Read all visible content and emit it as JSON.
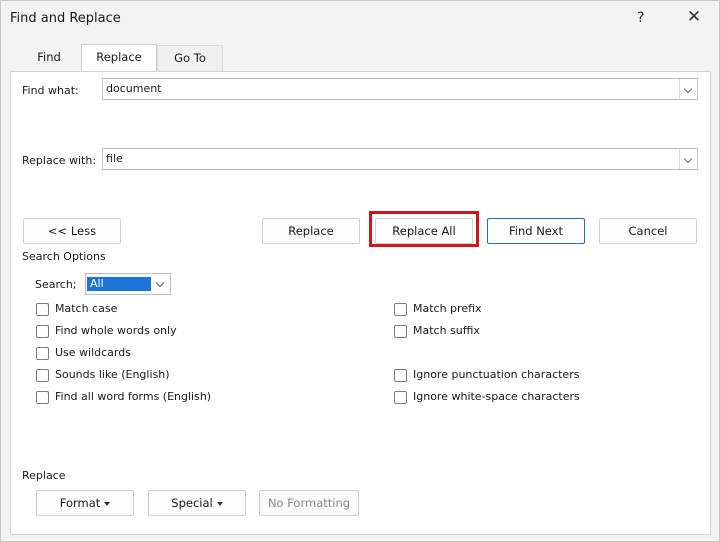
{
  "window": {
    "title": "Find and Replace",
    "help_label": "?",
    "close_label": "✕"
  },
  "tabs": [
    {
      "label": "Find",
      "active": false
    },
    {
      "label": "Replace",
      "active": true
    },
    {
      "label": "Go To",
      "active": false
    }
  ],
  "find": {
    "label": "Find what:",
    "value": "document"
  },
  "replace": {
    "label": "Replace with:",
    "value": "file"
  },
  "buttons": {
    "less": "<< Less",
    "replace": "Replace",
    "replace_all": "Replace All",
    "find_next": "Find Next",
    "cancel": "Cancel"
  },
  "search_options": {
    "heading": "Search Options",
    "search_label": "Search;",
    "search_value": "All",
    "left": [
      {
        "label": "Match case",
        "checked": false
      },
      {
        "label": "Find whole words only",
        "checked": false
      },
      {
        "label": "Use wildcards",
        "checked": false
      },
      {
        "label": "Sounds like (English)",
        "checked": false
      },
      {
        "label": "Find all word forms (English)",
        "checked": false
      }
    ],
    "right": [
      {
        "label": "Match prefix",
        "checked": false
      },
      {
        "label": "Match suffix",
        "checked": false
      },
      {
        "label": "Ignore punctuation characters",
        "checked": false
      },
      {
        "label": "Ignore white-space characters",
        "checked": false
      }
    ]
  },
  "replace_section": {
    "heading": "Replace",
    "format": "Format",
    "special": "Special",
    "no_formatting": "No Formatting"
  },
  "colors": {
    "accent": "#1e73d8",
    "highlight": "#d2151d",
    "primary_border": "#2a6fb5"
  }
}
